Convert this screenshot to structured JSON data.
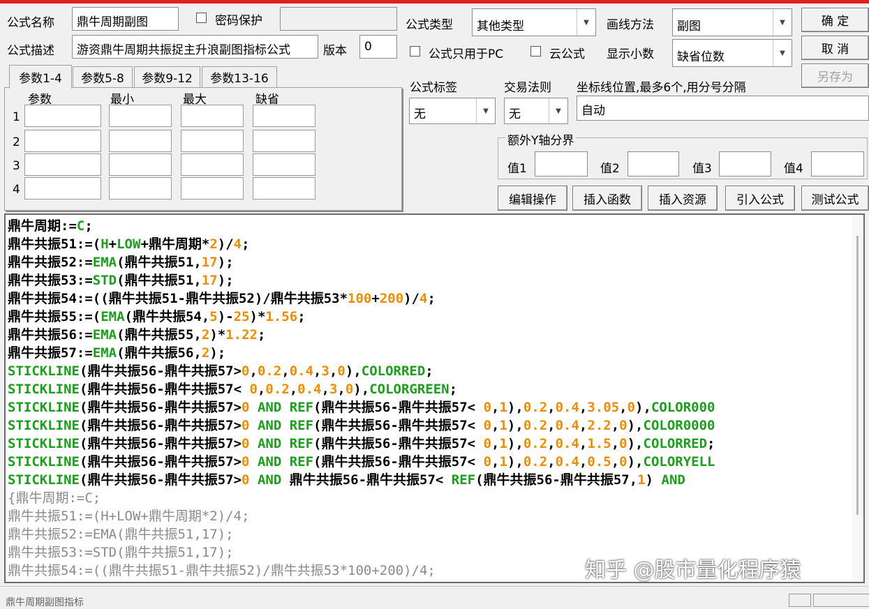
{
  "form": {
    "name_label": "公式名称",
    "name_value": "鼎牛周期副图",
    "password_label": "密码保护",
    "password_value": "",
    "desc_label": "公式描述",
    "desc_value": "游资鼎牛周期共振捉主升浪副图指标公式",
    "version_label": "版本",
    "version_value": "0",
    "type_label": "公式类型",
    "type_value": "其他类型",
    "draw_label": "画线方法",
    "draw_value": "副图",
    "pc_only_label": "公式只用于PC",
    "cloud_label": "云公式",
    "decimal_label": "显示小数",
    "decimal_value": "缺省位数",
    "tag_label": "公式标签",
    "tag_value": "无",
    "trade_label": "交易法则",
    "trade_value": "无",
    "coord_label": "坐标线位置,最多6个,用分号分隔",
    "coord_value": "自动",
    "extra_y_label": "额外Y轴分界",
    "val1_label": "值1",
    "val2_label": "值2",
    "val3_label": "值3",
    "val4_label": "值4"
  },
  "buttons": {
    "ok": "确 定",
    "cancel": "取 消",
    "save_as": "另存为",
    "edit_ops": "编辑操作",
    "insert_func": "插入函数",
    "insert_res": "插入资源",
    "import_formula": "引入公式",
    "test_formula": "测试公式"
  },
  "tabs": [
    "参数1-4",
    "参数5-8",
    "参数9-12",
    "参数13-16"
  ],
  "params": {
    "headers": [
      "参数",
      "最小",
      "最大",
      "缺省"
    ],
    "rows": [
      "1",
      "2",
      "3",
      "4"
    ]
  },
  "code_lines": [
    [
      [
        "k",
        "鼎牛周期:="
      ],
      [
        "g",
        "C"
      ],
      [
        "k",
        ";"
      ]
    ],
    [
      [
        "k",
        "鼎牛共振51:=("
      ],
      [
        "g",
        "H"
      ],
      [
        "k",
        "+"
      ],
      [
        "g",
        "LOW"
      ],
      [
        "k",
        "+鼎牛周期*"
      ],
      [
        "o",
        "2"
      ],
      [
        "k",
        ")/"
      ],
      [
        "o",
        "4"
      ],
      [
        "k",
        ";"
      ]
    ],
    [
      [
        "k",
        "鼎牛共振52:="
      ],
      [
        "g",
        "EMA"
      ],
      [
        "k",
        "(鼎牛共振51,"
      ],
      [
        "o",
        "17"
      ],
      [
        "k",
        ");"
      ]
    ],
    [
      [
        "k",
        "鼎牛共振53:="
      ],
      [
        "g",
        "STD"
      ],
      [
        "k",
        "(鼎牛共振51,"
      ],
      [
        "o",
        "17"
      ],
      [
        "k",
        ");"
      ]
    ],
    [
      [
        "k",
        "鼎牛共振54:=((鼎牛共振51-鼎牛共振52)/鼎牛共振53*"
      ],
      [
        "o",
        "100"
      ],
      [
        "k",
        "+"
      ],
      [
        "o",
        "200"
      ],
      [
        "k",
        ")/"
      ],
      [
        "o",
        "4"
      ],
      [
        "k",
        ";"
      ]
    ],
    [
      [
        "k",
        "鼎牛共振55:=("
      ],
      [
        "g",
        "EMA"
      ],
      [
        "k",
        "(鼎牛共振54,"
      ],
      [
        "o",
        "5"
      ],
      [
        "k",
        ")-"
      ],
      [
        "o",
        "25"
      ],
      [
        "k",
        ")*"
      ],
      [
        "o",
        "1.56"
      ],
      [
        "k",
        ";"
      ]
    ],
    [
      [
        "k",
        "鼎牛共振56:="
      ],
      [
        "g",
        "EMA"
      ],
      [
        "k",
        "(鼎牛共振55,"
      ],
      [
        "o",
        "2"
      ],
      [
        "k",
        ")*"
      ],
      [
        "o",
        "1.22"
      ],
      [
        "k",
        ";"
      ]
    ],
    [
      [
        "k",
        "鼎牛共振57:="
      ],
      [
        "g",
        "EMA"
      ],
      [
        "k",
        "(鼎牛共振56,"
      ],
      [
        "o",
        "2"
      ],
      [
        "k",
        ");"
      ]
    ],
    [
      [
        "g",
        "STICKLINE"
      ],
      [
        "k",
        "(鼎牛共振56-鼎牛共振57>"
      ],
      [
        "o",
        "0"
      ],
      [
        "k",
        ","
      ],
      [
        "o",
        "0.2"
      ],
      [
        "k",
        ","
      ],
      [
        "o",
        "0.4"
      ],
      [
        "k",
        ","
      ],
      [
        "o",
        "3"
      ],
      [
        "k",
        ","
      ],
      [
        "o",
        "0"
      ],
      [
        "k",
        "),"
      ],
      [
        "g",
        "COLORRED"
      ],
      [
        "k",
        ";"
      ]
    ],
    [
      [
        "g",
        "STICKLINE"
      ],
      [
        "k",
        "(鼎牛共振56-鼎牛共振57< "
      ],
      [
        "o",
        "0"
      ],
      [
        "k",
        ","
      ],
      [
        "o",
        "0.2"
      ],
      [
        "k",
        ","
      ],
      [
        "o",
        "0.4"
      ],
      [
        "k",
        ","
      ],
      [
        "o",
        "3"
      ],
      [
        "k",
        ","
      ],
      [
        "o",
        "0"
      ],
      [
        "k",
        "),"
      ],
      [
        "g",
        "COLORGREEN"
      ],
      [
        "k",
        ";"
      ]
    ],
    [
      [
        "g",
        "STICKLINE"
      ],
      [
        "k",
        "(鼎牛共振56-鼎牛共振57>"
      ],
      [
        "o",
        "0"
      ],
      [
        "k",
        " "
      ],
      [
        "g",
        "AND"
      ],
      [
        "k",
        " "
      ],
      [
        "g",
        "REF"
      ],
      [
        "k",
        "(鼎牛共振56-鼎牛共振57< "
      ],
      [
        "o",
        "0"
      ],
      [
        "k",
        ","
      ],
      [
        "o",
        "1"
      ],
      [
        "k",
        "),"
      ],
      [
        "o",
        "0.2"
      ],
      [
        "k",
        ","
      ],
      [
        "o",
        "0.4"
      ],
      [
        "k",
        ","
      ],
      [
        "o",
        "3.05"
      ],
      [
        "k",
        ","
      ],
      [
        "o",
        "0"
      ],
      [
        "k",
        "),"
      ],
      [
        "g",
        "COLOR000"
      ]
    ],
    [
      [
        "g",
        "STICKLINE"
      ],
      [
        "k",
        "(鼎牛共振56-鼎牛共振57>"
      ],
      [
        "o",
        "0"
      ],
      [
        "k",
        " "
      ],
      [
        "g",
        "AND"
      ],
      [
        "k",
        " "
      ],
      [
        "g",
        "REF"
      ],
      [
        "k",
        "(鼎牛共振56-鼎牛共振57< "
      ],
      [
        "o",
        "0"
      ],
      [
        "k",
        ","
      ],
      [
        "o",
        "1"
      ],
      [
        "k",
        "),"
      ],
      [
        "o",
        "0.2"
      ],
      [
        "k",
        ","
      ],
      [
        "o",
        "0.4"
      ],
      [
        "k",
        ","
      ],
      [
        "o",
        "2.2"
      ],
      [
        "k",
        ","
      ],
      [
        "o",
        "0"
      ],
      [
        "k",
        "),"
      ],
      [
        "g",
        "COLOR0000"
      ]
    ],
    [
      [
        "g",
        "STICKLINE"
      ],
      [
        "k",
        "(鼎牛共振56-鼎牛共振57>"
      ],
      [
        "o",
        "0"
      ],
      [
        "k",
        " "
      ],
      [
        "g",
        "AND"
      ],
      [
        "k",
        " "
      ],
      [
        "g",
        "REF"
      ],
      [
        "k",
        "(鼎牛共振56-鼎牛共振57< "
      ],
      [
        "o",
        "0"
      ],
      [
        "k",
        ","
      ],
      [
        "o",
        "1"
      ],
      [
        "k",
        "),"
      ],
      [
        "o",
        "0.2"
      ],
      [
        "k",
        ","
      ],
      [
        "o",
        "0.4"
      ],
      [
        "k",
        ","
      ],
      [
        "o",
        "1.5"
      ],
      [
        "k",
        ","
      ],
      [
        "o",
        "0"
      ],
      [
        "k",
        "),"
      ],
      [
        "g",
        "COLORRED"
      ],
      [
        "k",
        ";"
      ]
    ],
    [
      [
        "g",
        "STICKLINE"
      ],
      [
        "k",
        "(鼎牛共振56-鼎牛共振57>"
      ],
      [
        "o",
        "0"
      ],
      [
        "k",
        " "
      ],
      [
        "g",
        "AND"
      ],
      [
        "k",
        " "
      ],
      [
        "g",
        "REF"
      ],
      [
        "k",
        "(鼎牛共振56-鼎牛共振57< "
      ],
      [
        "o",
        "0"
      ],
      [
        "k",
        ","
      ],
      [
        "o",
        "1"
      ],
      [
        "k",
        "),"
      ],
      [
        "o",
        "0.2"
      ],
      [
        "k",
        ","
      ],
      [
        "o",
        "0.4"
      ],
      [
        "k",
        ","
      ],
      [
        "o",
        "0.5"
      ],
      [
        "k",
        ","
      ],
      [
        "o",
        "0"
      ],
      [
        "k",
        "),"
      ],
      [
        "g",
        "COLORYELL"
      ]
    ],
    [
      [
        "g",
        "STICKLINE"
      ],
      [
        "k",
        "(鼎牛共振56-鼎牛共振57>"
      ],
      [
        "o",
        "0"
      ],
      [
        "k",
        " "
      ],
      [
        "g",
        "AND"
      ],
      [
        "k",
        " 鼎牛共振56-鼎牛共振57< "
      ],
      [
        "g",
        "REF"
      ],
      [
        "k",
        "(鼎牛共振56-鼎牛共振57,"
      ],
      [
        "o",
        "1"
      ],
      [
        "k",
        ") "
      ],
      [
        "g",
        "AND"
      ]
    ],
    [
      [
        "gr",
        "{鼎牛周期:=C;"
      ]
    ],
    [
      [
        "gr",
        "鼎牛共振51:=(H+LOW+鼎牛周期*2)/4;"
      ]
    ],
    [
      [
        "gr",
        "鼎牛共振52:=EMA(鼎牛共振51,17);"
      ]
    ],
    [
      [
        "gr",
        "鼎牛共振53:=STD(鼎牛共振51,17);"
      ]
    ],
    [
      [
        "gr",
        "鼎牛共振54:=((鼎牛共振51-鼎牛共振52)/鼎牛共振53*100+200)/4;"
      ]
    ]
  ],
  "watermark": "知乎 @股市量化程序猿",
  "status_text": "鼎牛周期副图指标"
}
